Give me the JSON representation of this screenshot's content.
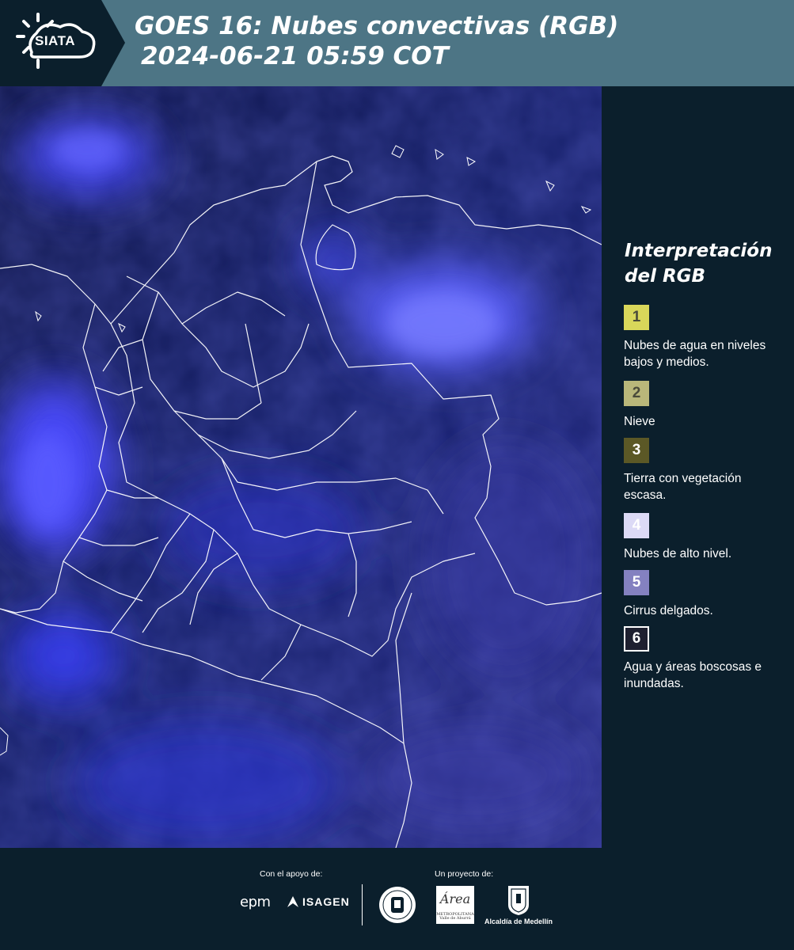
{
  "header": {
    "logo_text": "SIATA",
    "title_line1": "GOES 16: Nubes convectivas (RGB)",
    "title_line2": "2024-06-21 05:59 COT",
    "background_color": "#4d7585"
  },
  "map": {
    "description_icon": "colombia-satellite-map",
    "ocean_color": "#111a48",
    "cloud_color": "#3b3bff",
    "border_color": "#ffffff"
  },
  "legend": {
    "title": "Interpretación del RGB",
    "items": [
      {
        "number": "1",
        "label": "Nubes de agua en niveles bajos y medios.",
        "color": "#d9d75a"
      },
      {
        "number": "2",
        "label": "Nieve",
        "color": "#b9b77a"
      },
      {
        "number": "3",
        "label": "Tierra con vegetación escasa.",
        "color": "#5b5826"
      },
      {
        "number": "4",
        "label": "Nubes de alto nivel.",
        "color": "#dcdaf6"
      },
      {
        "number": "5",
        "label": "Cirrus delgados.",
        "color": "#8481c0"
      },
      {
        "number": "6",
        "label": "Agua y áreas boscosas e inundadas.",
        "color": "#1e2030"
      }
    ]
  },
  "footer": {
    "support_label": "Con el apoyo de:",
    "project_label": "Un proyecto de:",
    "sponsors": [
      "epm",
      "ISAGEN"
    ],
    "area_logo_text": "Área",
    "area_logo_sub": "METROPOLITANA Valle de Aburrá",
    "alcaldia_label": "Alcaldía de Medellín"
  }
}
